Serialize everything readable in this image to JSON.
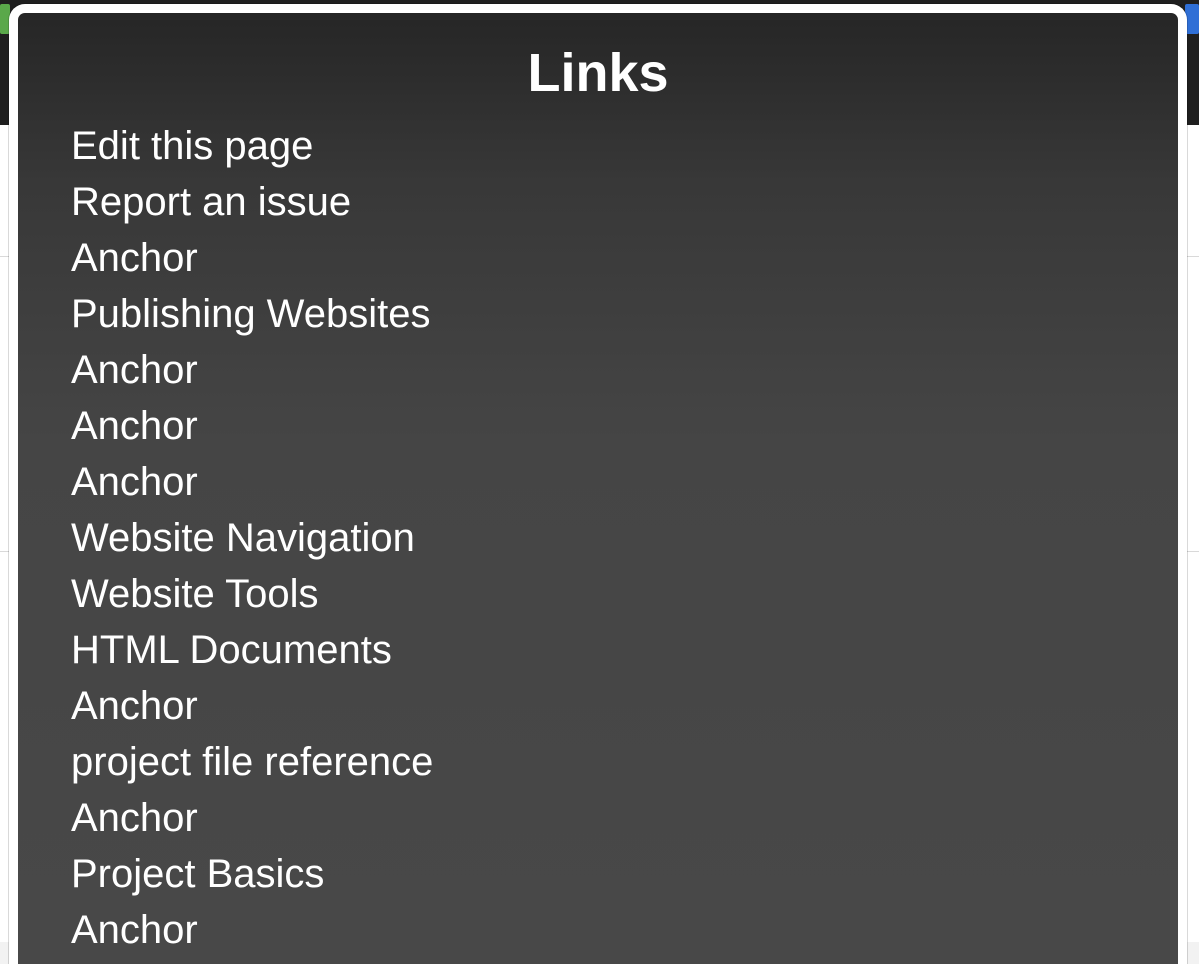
{
  "panel": {
    "title": "Links",
    "links": [
      "Edit this page",
      "Report an issue",
      "Anchor",
      "Publishing Websites",
      "Anchor",
      "Anchor",
      "Anchor",
      "Website Navigation",
      "Website Tools",
      "HTML Documents",
      "Anchor",
      "project file reference",
      "Anchor",
      "Project Basics",
      "Anchor"
    ]
  },
  "colors": {
    "panel_background": "#454545",
    "panel_border": "#ffffff",
    "text": "#ffffff",
    "header_bar": "#1f1f1f"
  }
}
